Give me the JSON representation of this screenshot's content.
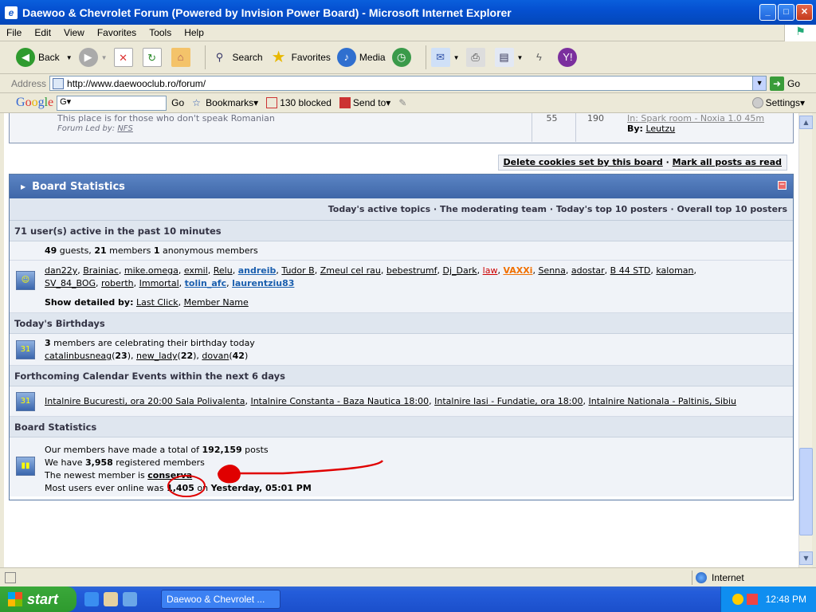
{
  "window": {
    "title": "Daewoo & Chevrolet Forum (Powered by Invision Power Board) - Microsoft Internet Explorer"
  },
  "menu": [
    "File",
    "Edit",
    "View",
    "Favorites",
    "Tools",
    "Help"
  ],
  "toolbar": {
    "back": "Back",
    "search": "Search",
    "favorites": "Favorites",
    "media": "Media"
  },
  "address": {
    "label": "Address",
    "url": "http://www.daewooclub.ro/forum/",
    "go": "Go"
  },
  "google": {
    "logo": "Google",
    "go": "Go",
    "bookmarks": "Bookmarks",
    "blocked": "130 blocked",
    "sendto": "Send to",
    "settings": "Settings"
  },
  "forum_row": {
    "desc": "This place is for those who don't speak Romanian",
    "led_label": "Forum Led by:",
    "led_by": "NFS",
    "topics": "55",
    "replies": "190",
    "last_post_title": "In: Spark room - Noxia 1.0 45m",
    "last_by_label": "By:",
    "last_by": "Leutzu"
  },
  "cookies": {
    "delete": "Delete cookies set by this board",
    "sep": "·",
    "mark": "Mark all posts as read"
  },
  "stats": {
    "title": "Board Statistics",
    "links": "Today's active topics · The moderating team · Today's top 10 posters · Overall top 10 posters",
    "active_header": "71 user(s) active in the past 10 minutes",
    "guests_n": "49",
    "guests_t": " guests, ",
    "members_n": "21",
    "members_t": " members ",
    "anon_n": "1",
    "anon_t": " anonymous members",
    "users": [
      "dan22y",
      "Brainiac",
      "mike.omega",
      "exmil",
      "Relu",
      "andreib",
      "Tudor B",
      "Zmeul cel rau",
      "bebestrumf",
      "Dj_Dark",
      "law",
      "VAXXi",
      "Senna",
      "adostar",
      "B 44 STD",
      "kaloman",
      "SV_84_BOG",
      "roberth",
      "Immortal",
      "tolin_afc",
      "laurentziu83"
    ],
    "show_label": "Show detailed by:",
    "show_last": "Last Click",
    "show_name": "Member Name",
    "birthdays_header": "Today's Birthdays",
    "bday_n": "3",
    "bday_t": " members are celebrating their birthday today",
    "bdays": [
      {
        "name": "catalinbusneag",
        "age": "23"
      },
      {
        "name": "new_lady",
        "age": "22"
      },
      {
        "name": "dovan",
        "age": "42"
      }
    ],
    "calendar_header": "Forthcoming Calendar Events within the next 6 days",
    "events": [
      "Intalnire Bucuresti, ora 20:00 Sala Polivalenta",
      "Intalnire Constanta - Baza Nautica 18:00",
      "Intalnire Iasi - Fundatie, ora 18:00",
      "Intalnire Nationala - Paltinis, Sibiu"
    ],
    "board_header": "Board Statistics",
    "posts_pre": "Our members have made a total of ",
    "posts_n": "192,159",
    "posts_post": " posts",
    "reg_pre": "We have ",
    "reg_n": "3,958",
    "reg_post": " registered members",
    "newest_pre": "The newest member is ",
    "newest": "conserva",
    "online_pre": "Most users ever online was ",
    "online_n": "1,405",
    "online_mid": " on ",
    "online_date": "Yesterday, 05:01 PM"
  },
  "status": {
    "zone": "Internet"
  },
  "taskbar": {
    "start": "start",
    "item": "Daewoo & Chevrolet ...",
    "clock": "12:48 PM"
  },
  "colors": {
    "annotation": "#e00000",
    "panel_header": "#4a72b4"
  }
}
